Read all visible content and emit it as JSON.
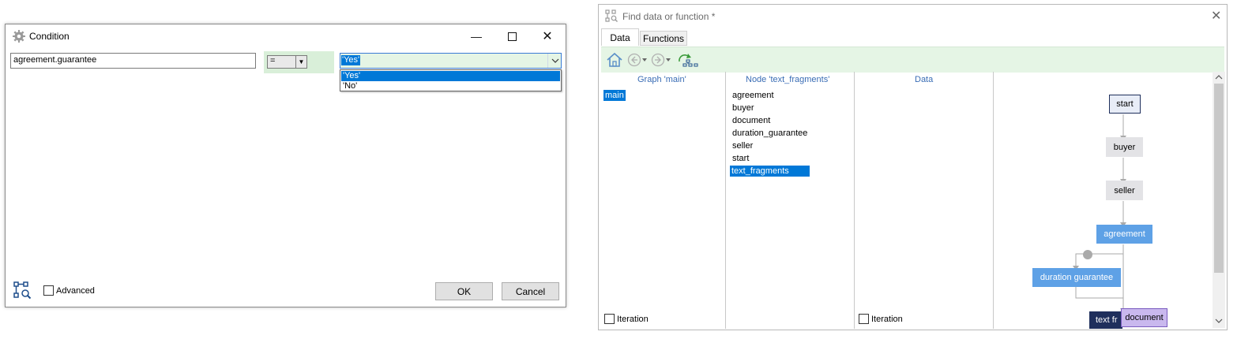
{
  "condition_dialog": {
    "title": "Condition",
    "field_value": "agreement.guarantee",
    "operator": "=",
    "value_selected": "'Yes'",
    "options": [
      "'Yes'",
      "'No'"
    ],
    "advanced_label": "Advanced",
    "ok_label": "OK",
    "cancel_label": "Cancel"
  },
  "find_panel": {
    "title": "Find data or function *",
    "tabs": [
      "Data",
      "Functions"
    ],
    "graph_header": "Graph 'main'",
    "node_header": "Node 'text_fragments'",
    "data_header": "Data",
    "graph_items": [
      "main"
    ],
    "node_items": [
      "agreement",
      "buyer",
      "document",
      "duration_guarantee",
      "seller",
      "start",
      "text_fragments"
    ],
    "iteration_label": "Iteration",
    "iteration_label_2": "Iteration",
    "flow_nodes": {
      "start": "start",
      "buyer": "buyer",
      "seller": "seller",
      "agreement": "agreement",
      "duration": "duration guarantee",
      "textfr": "text fr",
      "document": "document"
    }
  },
  "colors": {
    "selection": "#0078d7",
    "panel_green": "#e5f5e5",
    "node_blue": "#5ea1e6",
    "node_dark": "#1f2f5c",
    "node_purple": "#c9b8ee",
    "header_blue": "#3a6db5"
  }
}
